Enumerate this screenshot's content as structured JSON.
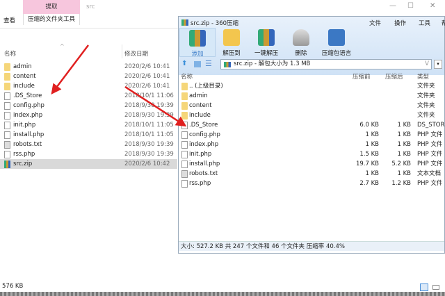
{
  "explorer": {
    "ribbon_tab_extract": "提取",
    "window_title": "src",
    "tab_view": "查看",
    "tab_tools": "压缩的文件夹工具",
    "col_name": "名称",
    "col_date": "修改日期",
    "files": [
      {
        "name": "admin",
        "date": "2020/2/6 10:41",
        "type": "folder"
      },
      {
        "name": "content",
        "date": "2020/2/6 10:41",
        "type": "folder"
      },
      {
        "name": "include",
        "date": "2020/2/6 10:41",
        "type": "folder"
      },
      {
        "name": ".DS_Store",
        "date": "2018/10/1 11:06",
        "type": "file"
      },
      {
        "name": "config.php",
        "date": "2018/9/30 19:39",
        "type": "file"
      },
      {
        "name": "index.php",
        "date": "2018/9/30 19:39",
        "type": "file"
      },
      {
        "name": "init.php",
        "date": "2018/10/1 11:05",
        "type": "file"
      },
      {
        "name": "install.php",
        "date": "2018/10/1 11:05",
        "type": "file"
      },
      {
        "name": "robots.txt",
        "date": "2018/9/30 19:39",
        "type": "txt"
      },
      {
        "name": "rss.php",
        "date": "2018/9/30 19:39",
        "type": "file"
      },
      {
        "name": "src.zip",
        "date": "2020/2/6 10:42",
        "type": "zip"
      }
    ],
    "status": "576 KB"
  },
  "zip": {
    "title": "src.zip - 360压缩",
    "menu": [
      "文件",
      "操作",
      "工具",
      "帮"
    ],
    "tools": [
      "添加",
      "解压到",
      "一键解压",
      "删除",
      "压缩包语言"
    ],
    "address": "src.zip - 解包大小为 1.3 MB",
    "cols": [
      "名称",
      "压缩前",
      "压缩后",
      "类型"
    ],
    "rows": [
      {
        "name": ".. (上级目录)",
        "before": "",
        "after": "",
        "type": "文件夹",
        "icon": "folder"
      },
      {
        "name": "admin",
        "before": "",
        "after": "",
        "type": "文件夹",
        "icon": "folder"
      },
      {
        "name": "content",
        "before": "",
        "after": "",
        "type": "文件夹",
        "icon": "folder"
      },
      {
        "name": "include",
        "before": "",
        "after": "",
        "type": "文件夹",
        "icon": "folder"
      },
      {
        "name": ".DS_Store",
        "before": "6.0 KB",
        "after": "1 KB",
        "type": "DS_STORE",
        "icon": "file"
      },
      {
        "name": "config.php",
        "before": "1 KB",
        "after": "1 KB",
        "type": "PHP 文件",
        "icon": "file"
      },
      {
        "name": "index.php",
        "before": "1 KB",
        "after": "1 KB",
        "type": "PHP 文件",
        "icon": "file"
      },
      {
        "name": "init.php",
        "before": "1.5 KB",
        "after": "1 KB",
        "type": "PHP 文件",
        "icon": "file"
      },
      {
        "name": "install.php",
        "before": "19.7 KB",
        "after": "5.2 KB",
        "type": "PHP 文件",
        "icon": "file"
      },
      {
        "name": "robots.txt",
        "before": "1 KB",
        "after": "1 KB",
        "type": "文本文档",
        "icon": "txt"
      },
      {
        "name": "rss.php",
        "before": "2.7 KB",
        "after": "1.2 KB",
        "type": "PHP 文件",
        "icon": "file"
      }
    ],
    "status": "大小: 527.2 KB 共 247 个文件和 46 个文件夹 压缩率 40.4%"
  }
}
